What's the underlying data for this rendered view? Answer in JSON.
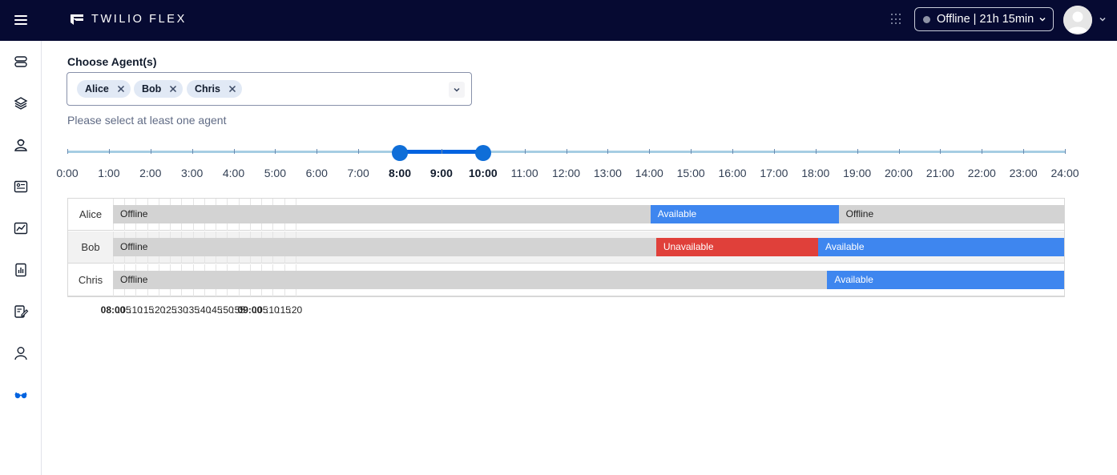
{
  "header": {
    "brand": "TWILIO FLEX",
    "status_text": "Offline | 21h 15min"
  },
  "form": {
    "choose_label": "Choose Agent(s)",
    "selected_agents": [
      "Alice",
      "Bob",
      "Chris"
    ],
    "helper_text": "Please select at least one agent"
  },
  "slider": {
    "hours": [
      "0:00",
      "1:00",
      "2:00",
      "3:00",
      "4:00",
      "5:00",
      "6:00",
      "7:00",
      "8:00",
      "9:00",
      "10:00",
      "11:00",
      "12:00",
      "13:00",
      "14:00",
      "15:00",
      "16:00",
      "17:00",
      "18:00",
      "19:00",
      "20:00",
      "21:00",
      "22:00",
      "23:00",
      "24:00"
    ],
    "range_start_hour": 8,
    "range_end_hour": 10,
    "active_labels": [
      "8:00",
      "9:00",
      "10:00"
    ]
  },
  "timeline": {
    "time_labels": [
      "08:00",
      ":05",
      ":10",
      ":15",
      ":20",
      ":25",
      ":30",
      ":35",
      ":40",
      ":45",
      ":50",
      ":55",
      "09:00",
      ":05",
      ":10",
      ":15",
      ":20"
    ],
    "major_labels": [
      "08:00",
      "09:00"
    ],
    "rows": [
      {
        "agent": "Alice",
        "segments": [
          {
            "status": "Offline",
            "type": "offline",
            "start_min": 0,
            "end_min": 47.1
          },
          {
            "status": "Available",
            "type": "available",
            "start_min": 47.1,
            "end_min": 63.6
          },
          {
            "status": "Offline",
            "type": "offline",
            "start_min": 63.6,
            "end_min": 83.4
          }
        ]
      },
      {
        "agent": "Bob",
        "segments": [
          {
            "status": "Offline",
            "type": "offline",
            "start_min": 0,
            "end_min": 47.6
          },
          {
            "status": "Unavailable",
            "type": "unavailable",
            "start_min": 47.6,
            "end_min": 61.8
          },
          {
            "status": "Available",
            "type": "available",
            "start_min": 61.8,
            "end_min": 83.4
          }
        ]
      },
      {
        "agent": "Chris",
        "segments": [
          {
            "status": "Offline",
            "type": "offline",
            "start_min": 0,
            "end_min": 62.6
          },
          {
            "status": "Available",
            "type": "available",
            "start_min": 62.6,
            "end_min": 83.4
          }
        ]
      }
    ]
  },
  "icons": {
    "sidenav": [
      "queues-icon",
      "layers-icon",
      "agents-icon",
      "id-card-icon",
      "analytics-icon",
      "reports-icon",
      "edit-form-icon",
      "user-icon",
      "glasses-icon"
    ],
    "active_nav": "glasses-icon"
  },
  "colors": {
    "topbar": "#060a32",
    "available": "#3e86ef",
    "unavailable": "#e0403a",
    "offline": "#d3d3d3",
    "slider_accent": "#0263e0"
  }
}
